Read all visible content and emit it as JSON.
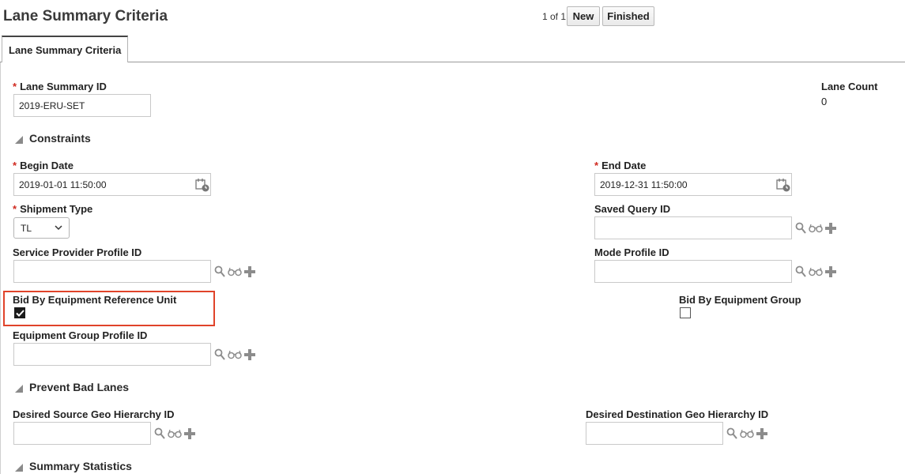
{
  "header": {
    "title": "Lane Summary Criteria",
    "pager": "1 of 1",
    "new_label": "New",
    "finished_label": "Finished"
  },
  "tabs": [
    {
      "label": "Lane Summary Criteria",
      "active": true
    }
  ],
  "fields": {
    "lane_summary_id": {
      "label": "Lane Summary ID",
      "required": true,
      "value": "2019-ERU-SET"
    },
    "lane_count": {
      "label": "Lane Count",
      "value": "0"
    },
    "begin_date": {
      "label": "Begin Date",
      "required": true,
      "value": "2019-01-01 11:50:00"
    },
    "end_date": {
      "label": "End Date",
      "required": true,
      "value": "2019-12-31 11:50:00"
    },
    "shipment_type": {
      "label": "Shipment Type",
      "required": true,
      "value": "TL"
    },
    "saved_query_id": {
      "label": "Saved Query ID",
      "value": ""
    },
    "service_provider_profile_id": {
      "label": "Service Provider Profile ID",
      "value": ""
    },
    "mode_profile_id": {
      "label": "Mode Profile ID",
      "value": ""
    },
    "bid_by_equipment_reference_unit": {
      "label": "Bid By Equipment Reference Unit",
      "checked": true
    },
    "bid_by_equipment_group": {
      "label": "Bid By Equipment Group",
      "checked": false
    },
    "equipment_group_profile_id": {
      "label": "Equipment Group Profile ID",
      "value": ""
    },
    "desired_source_geo_hierarchy_id": {
      "label": "Desired Source Geo Hierarchy ID",
      "value": ""
    },
    "desired_destination_geo_hierarchy_id": {
      "label": "Desired Destination Geo Hierarchy ID",
      "value": ""
    }
  },
  "sections": {
    "constraints": "Constraints",
    "prevent_bad_lanes": "Prevent Bad Lanes",
    "summary_statistics": "Summary Statistics"
  },
  "required_marker": "*",
  "colors": {
    "required": "#d02a20",
    "highlight": "#e0432a",
    "icon_gray": "#8c8c8c"
  },
  "icons": [
    "calendar-icon",
    "search-icon",
    "glasses-icon",
    "plus-icon",
    "collapse-triangle-icon",
    "chevron-down-icon",
    "checkmark-icon"
  ]
}
